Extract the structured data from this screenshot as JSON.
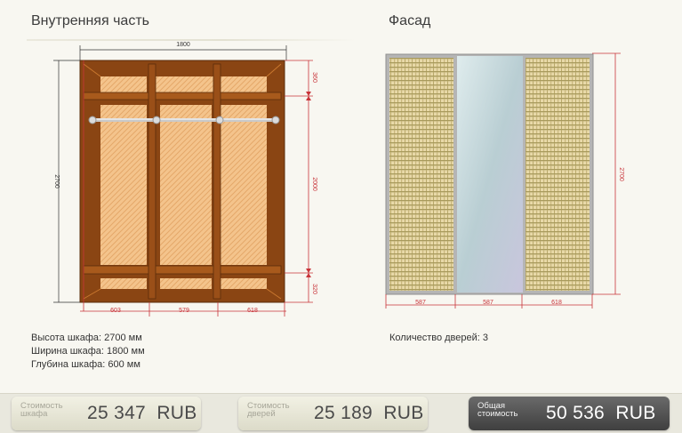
{
  "left": {
    "title": "Внутренняя часть",
    "dims": {
      "width": "1800",
      "height": "2700",
      "top_shelf": "360",
      "middle": "2000",
      "bottom_shelf": "320",
      "col1": "603",
      "col2": "579",
      "col3": "618"
    },
    "info": [
      "Высота шкафа: 2700 мм",
      "Ширина шкафа: 1800 мм",
      "Глубина шкафа: 600 мм"
    ]
  },
  "right": {
    "title": "Фасад",
    "dims": {
      "height": "2700",
      "door1": "587",
      "door2": "587",
      "door3": "618"
    },
    "info": "Количество дверей: 3"
  },
  "costs": [
    {
      "label_line1": "Стоимость",
      "label_line2": "шкафа",
      "value": "25 347",
      "currency": "RUB"
    },
    {
      "label_line1": "Стоимость",
      "label_line2": "дверей",
      "value": "25 189",
      "currency": "RUB"
    },
    {
      "label_line1": "Общая",
      "label_line2": "стоимость",
      "value": "50 536",
      "currency": "RUB"
    }
  ],
  "colors": {
    "wood": "#8b4513",
    "panel": "#f0c08a",
    "dimension": "#c8343a",
    "rattan": "#e6d7a7",
    "mirror": "#c8dbe0"
  }
}
